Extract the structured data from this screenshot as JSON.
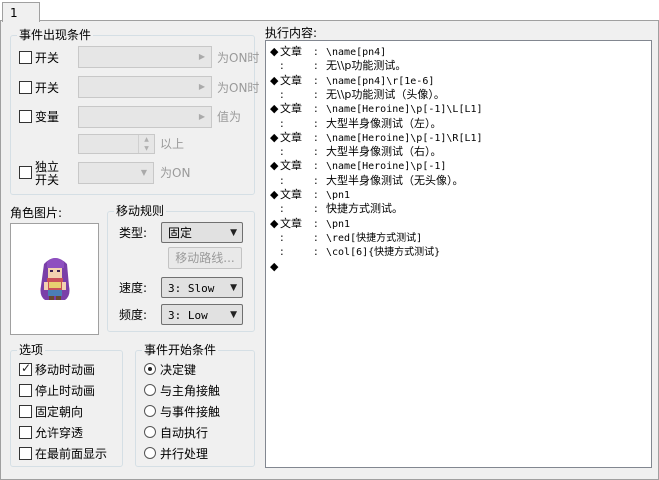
{
  "tabs": [
    {
      "label": "1"
    }
  ],
  "conditions": {
    "title": "事件出现条件",
    "switch1_label": "开关",
    "switch1_suffix": "为ON时",
    "switch2_label": "开关",
    "switch2_suffix": "为ON时",
    "variable_label": "变量",
    "variable_suffix": "值为",
    "variable_value_suffix": "以上",
    "self_switch_label_1": "独立",
    "self_switch_label_2": "开关",
    "self_switch_suffix": "为ON"
  },
  "graphic": {
    "title": "角色图片:"
  },
  "movement": {
    "title": "移动规则",
    "type_label": "类型:",
    "type_value": "固定",
    "route_button": "移动路线...",
    "speed_label": "速度:",
    "speed_value": "3: Slow",
    "freq_label": "频度:",
    "freq_value": "3: Low"
  },
  "options": {
    "title": "选项",
    "items": [
      {
        "label": "移动时动画",
        "checked": true
      },
      {
        "label": "停止时动画",
        "checked": false
      },
      {
        "label": "固定朝向",
        "checked": false
      },
      {
        "label": "允许穿透",
        "checked": false
      },
      {
        "label": "在最前面显示",
        "checked": false
      }
    ]
  },
  "trigger": {
    "title": "事件开始条件",
    "items": [
      {
        "label": "决定键",
        "selected": true
      },
      {
        "label": "与主角接触",
        "selected": false
      },
      {
        "label": "与事件接触",
        "selected": false
      },
      {
        "label": "自动执行",
        "selected": false
      },
      {
        "label": "并行处理",
        "selected": false
      }
    ]
  },
  "contents": {
    "title": "执行内容:",
    "lines": [
      {
        "marker": "◆",
        "head": "文章",
        "sep": ":",
        "code": "\\name[pn4]",
        "text": ""
      },
      {
        "marker": "",
        "head": ":",
        "sep": ":",
        "code": "",
        "text": "无\\\\p功能测试。"
      },
      {
        "marker": "◆",
        "head": "文章",
        "sep": ":",
        "code": "\\name[pn4]\\r[1e-6]",
        "text": ""
      },
      {
        "marker": "",
        "head": ":",
        "sep": ":",
        "code": "",
        "text": "无\\\\p功能测试（头像）。"
      },
      {
        "marker": "◆",
        "head": "文章",
        "sep": ":",
        "code": "\\name[Heroine]\\p[-1]\\L[L1]",
        "text": ""
      },
      {
        "marker": "",
        "head": ":",
        "sep": ":",
        "code": "",
        "text": "大型半身像测试（左）。"
      },
      {
        "marker": "◆",
        "head": "文章",
        "sep": ":",
        "code": "\\name[Heroine]\\p[-1]\\R[L1]",
        "text": ""
      },
      {
        "marker": "",
        "head": ":",
        "sep": ":",
        "code": "",
        "text": "大型半身像测试（右）。"
      },
      {
        "marker": "◆",
        "head": "文章",
        "sep": ":",
        "code": "\\name[Heroine]\\p[-1]",
        "text": ""
      },
      {
        "marker": "",
        "head": ":",
        "sep": ":",
        "code": "",
        "text": "大型半身像测试（无头像）。"
      },
      {
        "marker": "◆",
        "head": "文章",
        "sep": ":",
        "code": "\\pn1",
        "text": ""
      },
      {
        "marker": "",
        "head": ":",
        "sep": ":",
        "code": "",
        "text": "快捷方式测试。"
      },
      {
        "marker": "◆",
        "head": "文章",
        "sep": ":",
        "code": "\\pn1",
        "text": ""
      },
      {
        "marker": "",
        "head": ":",
        "sep": ":",
        "code": "\\red[快捷方式测试]",
        "text": ""
      },
      {
        "marker": "",
        "head": ":",
        "sep": ":",
        "code": "\\col[6]{快捷方式测试}",
        "text": ""
      },
      {
        "marker": "◆",
        "head": "",
        "sep": "",
        "code": "",
        "text": ""
      }
    ]
  },
  "colors": {
    "panel": "#f0f0f0",
    "border": "#a0a0a0",
    "group_border": "#d5dfe5"
  }
}
